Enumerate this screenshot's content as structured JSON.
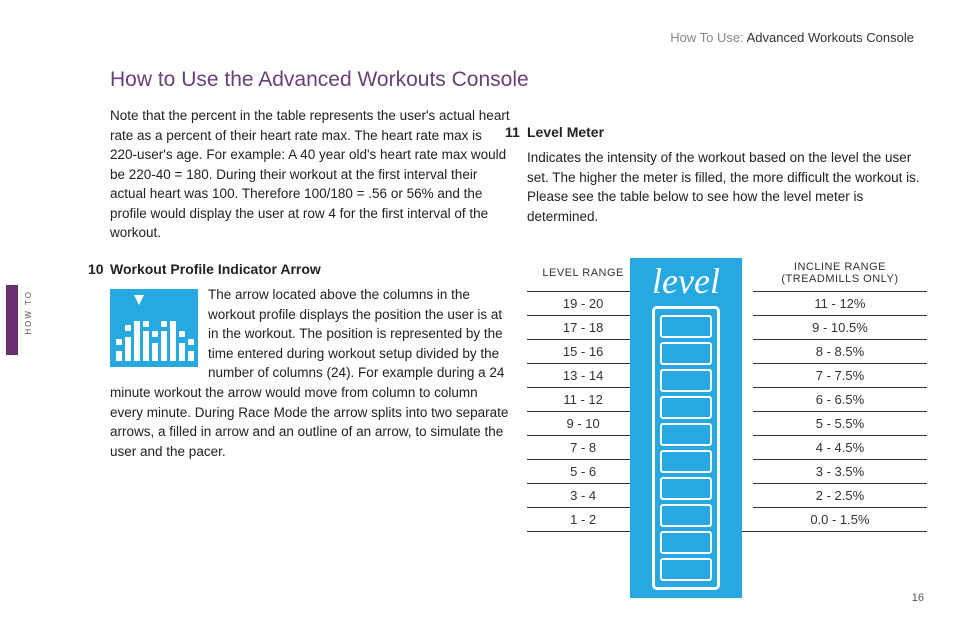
{
  "breadcrumb": {
    "prefix": "How To Use: ",
    "current": "Advanced Workouts Console"
  },
  "side_tab": "HOW TO",
  "title": "How to Use the Advanced Workouts Console",
  "page_number": "16",
  "intro": "Note that the percent in the table represents the user's actual heart rate as a percent of their heart rate max. The heart rate max is 220-user's age. For example:  A 40 year old's heart rate max would be 220-40 = 180. During their workout at the first interval their actual heart was 100. Therefore 100/180 = .56 or 56% and the profile would display the user at row 4 for the first interval of the workout.",
  "section10": {
    "num": "10",
    "heading": "Workout Profile Indicator Arrow",
    "body": "The arrow located above the columns in the workout profile displays the position the user is at in the workout. The position is represented by the time entered during workout setup divided by the number of columns (24). For example during a 24 minute workout the arrow would move from column to column every minute. During Race Mode the arrow splits into two separate arrows, a filled in arrow and an outline of an arrow, to simulate the user and the pacer."
  },
  "section11": {
    "num": "11",
    "heading": "Level Meter",
    "body": "Indicates the intensity of the workout based on the level the user set. The higher the meter is filled, the more difficult the workout is. Please see the table below to see how the level meter is determined."
  },
  "meter_label": "level",
  "chart_data": {
    "type": "table",
    "headers": {
      "level": "LEVEL RANGE",
      "incline": "INCLINE RANGE (TREADMILLS ONLY)"
    },
    "rows": [
      {
        "level": "19 - 20",
        "incline": "11 - 12%"
      },
      {
        "level": "17 - 18",
        "incline": "9 - 10.5%"
      },
      {
        "level": "15 - 16",
        "incline": "8 - 8.5%"
      },
      {
        "level": "13 - 14",
        "incline": "7 - 7.5%"
      },
      {
        "level": "11 - 12",
        "incline": "6 - 6.5%"
      },
      {
        "level": "9 - 10",
        "incline": "5 - 5.5%"
      },
      {
        "level": "7 - 8",
        "incline": "4 - 4.5%"
      },
      {
        "level": "5 - 6",
        "incline": "3 - 3.5%"
      },
      {
        "level": "3 - 4",
        "incline": "2 - 2.5%"
      },
      {
        "level": "1 - 2",
        "incline": "0.0 - 1.5%"
      }
    ]
  }
}
